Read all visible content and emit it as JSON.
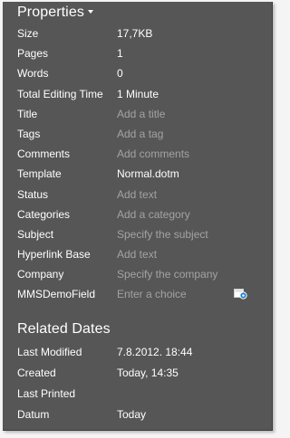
{
  "properties": {
    "title": "Properties",
    "items": [
      {
        "label": "Size",
        "value": "17,7KB",
        "placeholder": false
      },
      {
        "label": "Pages",
        "value": "1",
        "placeholder": false
      },
      {
        "label": "Words",
        "value": "0",
        "placeholder": false
      },
      {
        "label": "Total Editing Time",
        "value": "1 Minute",
        "placeholder": false
      },
      {
        "label": "Title",
        "value": "Add a title",
        "placeholder": true
      },
      {
        "label": "Tags",
        "value": "Add a tag",
        "placeholder": true
      },
      {
        "label": "Comments",
        "value": "Add comments",
        "placeholder": true
      },
      {
        "label": "Template",
        "value": "Normal.dotm",
        "placeholder": false
      },
      {
        "label": "Status",
        "value": "Add text",
        "placeholder": true
      },
      {
        "label": "Categories",
        "value": "Add a category",
        "placeholder": true
      },
      {
        "label": "Subject",
        "value": "Specify the subject",
        "placeholder": true
      },
      {
        "label": "Hyperlink Base",
        "value": "Add text",
        "placeholder": true
      },
      {
        "label": "Company",
        "value": "Specify the company",
        "placeholder": true
      },
      {
        "label": "MMSDemoField",
        "value": "Enter a choice",
        "placeholder": true,
        "icon": "choice-picker-icon"
      }
    ]
  },
  "related_dates": {
    "title": "Related Dates",
    "items": [
      {
        "label": "Last Modified",
        "value": "7.8.2012. 18:44"
      },
      {
        "label": "Created",
        "value": "Today, 14:35"
      },
      {
        "label": "Last Printed",
        "value": ""
      },
      {
        "label": "Datum",
        "value": "Today"
      }
    ]
  },
  "colors": {
    "panel_background": "#565656",
    "text": "#ffffff",
    "placeholder_text": "#a3a3a3",
    "icon_accent": "#1e7fd0"
  }
}
